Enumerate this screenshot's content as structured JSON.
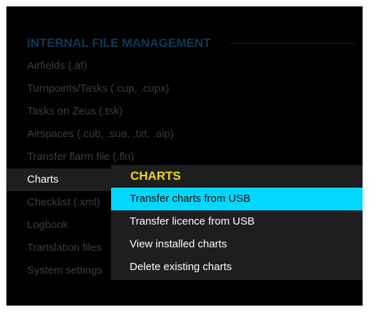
{
  "main_menu": {
    "title": "INTERNAL FILE MANAGEMENT",
    "items": [
      {
        "label": "Airfields (.af)"
      },
      {
        "label": "Turnpoints/Tasks (.cup, .cupx)"
      },
      {
        "label": "Tasks on Zeus (.tsk)"
      },
      {
        "label": "Airspaces (.cub, .sua, .txt, .aip)"
      },
      {
        "label": "Transfer flarm file (.fln)"
      },
      {
        "label": "Charts",
        "selected": true
      },
      {
        "label": "Checklist (.xml)"
      },
      {
        "label": "Logbook"
      },
      {
        "label": "Translation files"
      },
      {
        "label": "System settings"
      }
    ]
  },
  "submenu": {
    "title": "CHARTS",
    "items": [
      {
        "label": "Transfer charts from USB",
        "highlighted": true
      },
      {
        "label": "Transfer licence from USB"
      },
      {
        "label": "View installed charts"
      },
      {
        "label": "Delete existing charts"
      }
    ]
  },
  "colors": {
    "background": "#000000",
    "section_title": "#0b3a57",
    "dimmed_text": "#3b3b3b",
    "panel": "#1e1e1e",
    "submenu_title": "#f5dc00",
    "highlight": "#00d8ff"
  }
}
